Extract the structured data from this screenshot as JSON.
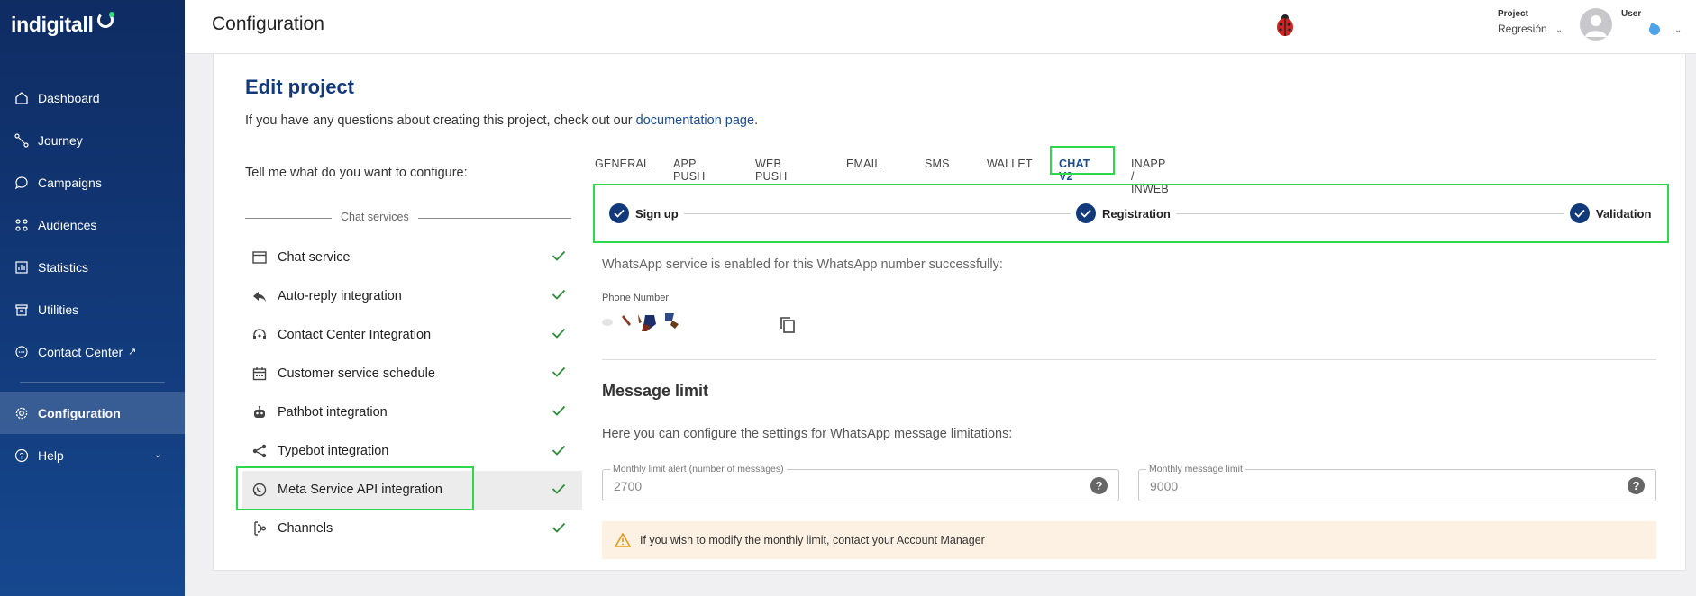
{
  "brand": {
    "logo_text": "indigitall"
  },
  "sidebar": {
    "items": [
      {
        "label": "Dashboard",
        "icon": "home-icon"
      },
      {
        "label": "Journey",
        "icon": "journey-icon"
      },
      {
        "label": "Campaigns",
        "icon": "chat-bubble-icon"
      },
      {
        "label": "Audiences",
        "icon": "audiences-icon"
      },
      {
        "label": "Statistics",
        "icon": "statistics-icon"
      },
      {
        "label": "Utilities",
        "icon": "archive-icon"
      },
      {
        "label": "Contact Center",
        "icon": "chat-dots-icon",
        "external_icon": "↗"
      }
    ],
    "bottom_items": [
      {
        "label": "Configuration",
        "icon": "gear-icon",
        "active": true
      },
      {
        "label": "Help",
        "icon": "help-icon",
        "chevron": "⌄"
      }
    ]
  },
  "header": {
    "title": "Configuration",
    "project_label": "Project",
    "project_value": "Regresión",
    "user_label": "User"
  },
  "main": {
    "title": "Edit project",
    "intro_text": "If you have any questions about creating this project, check out our ",
    "intro_link": "documentation page",
    "intro_end": ".",
    "ask": "Tell me what do you want to configure:",
    "section_label": "Chat services",
    "services": [
      {
        "label": "Chat service",
        "icon": "window-icon"
      },
      {
        "label": "Auto-reply integration",
        "icon": "reply-icon"
      },
      {
        "label": "Contact Center Integration",
        "icon": "headset-icon"
      },
      {
        "label": "Customer service schedule",
        "icon": "calendar-icon"
      },
      {
        "label": "Pathbot integration",
        "icon": "robot-icon"
      },
      {
        "label": "Typebot integration",
        "icon": "share-icon"
      },
      {
        "label": "Meta Service API integration",
        "icon": "whatsapp-icon",
        "selected": true
      },
      {
        "label": "Channels",
        "icon": "channels-icon"
      }
    ],
    "tabs": [
      "GENERAL",
      "APP PUSH",
      "WEB PUSH",
      "EMAIL",
      "SMS",
      "WALLET",
      "CHAT V2",
      "INAPP / INWEB"
    ],
    "active_tab": "CHAT V2",
    "steps": [
      "Sign up",
      "Registration",
      "Validation"
    ],
    "enabled_message": "WhatsApp service is enabled for this WhatsApp number successfully:",
    "phone_label": "Phone Number",
    "message_limit_title": "Message limit",
    "message_limit_desc": "Here you can configure the settings for WhatsApp message limitations:",
    "alert_field": {
      "label": "Monthly limit alert (number of messages)",
      "value": "2700"
    },
    "limit_field": {
      "label": "Monthly message limit",
      "value": "9000"
    },
    "warning": "If you wish to modify the monthly limit, contact your Account Manager"
  },
  "colors": {
    "sidebar_top": "#0f2c63",
    "accent": "#123a7a",
    "check_green": "#2e8b3a",
    "highlight": "#2bd94a",
    "warning_bg": "#fdf1e3"
  }
}
